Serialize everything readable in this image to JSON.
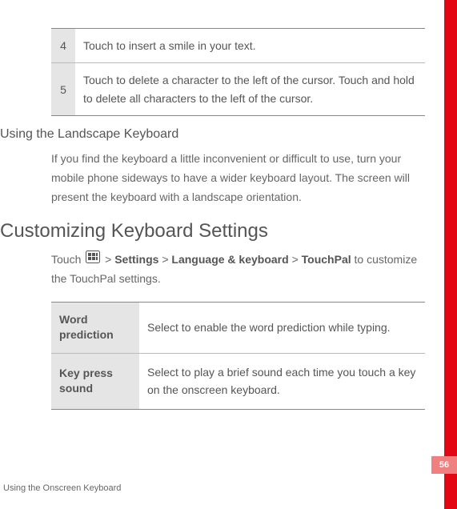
{
  "numTable": {
    "rows": [
      {
        "num": "4",
        "text": "Touch to insert a smile in your text."
      },
      {
        "num": "5",
        "text": "Touch to delete a character to the left of the cursor. Touch and hold to delete all characters to the left of the cursor."
      }
    ]
  },
  "subheading1": "Using the Landscape Keyboard",
  "para1": "If you find the keyboard a little inconvenient or difficult to use, turn your mobile phone sideways to have a wider keyboard layout. The screen will present the keyboard with a landscape orientation.",
  "sectionTitle": "Customizing Keyboard Settings",
  "touchPath": {
    "prefix": "Touch ",
    "sep": " > ",
    "parts": [
      "Settings",
      "Language & keyboard",
      "TouchPal"
    ],
    "suffix": " to customize the TouchPal settings."
  },
  "settingsTable": {
    "rows": [
      {
        "label": "Word prediction",
        "desc": "Select to enable the word prediction while typing."
      },
      {
        "label": "Key press sound",
        "desc": "Select to play a brief sound each time you touch a key on the onscreen keyboard."
      }
    ]
  },
  "pageNumber": "56",
  "footer": "Using the Onscreen Keyboard"
}
